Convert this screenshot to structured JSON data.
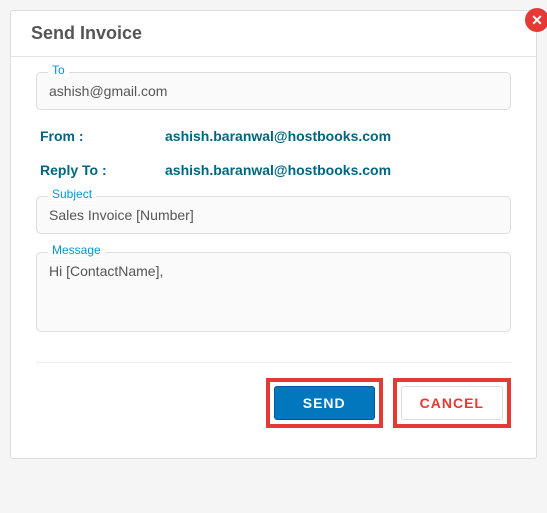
{
  "modal": {
    "title": "Send Invoice",
    "close_icon": "✕"
  },
  "fields": {
    "to": {
      "label": "To",
      "value": "ashish@gmail.com"
    },
    "from": {
      "label": "From :",
      "value": "ashish.baranwal@hostbooks.com"
    },
    "replyTo": {
      "label": "Reply To :",
      "value": "ashish.baranwal@hostbooks.com"
    },
    "subject": {
      "label": "Subject",
      "value": "Sales Invoice [Number]"
    },
    "message": {
      "label": "Message",
      "value": "Hi [ContactName],"
    }
  },
  "buttons": {
    "send": "SEND",
    "cancel": "CANCEL"
  }
}
